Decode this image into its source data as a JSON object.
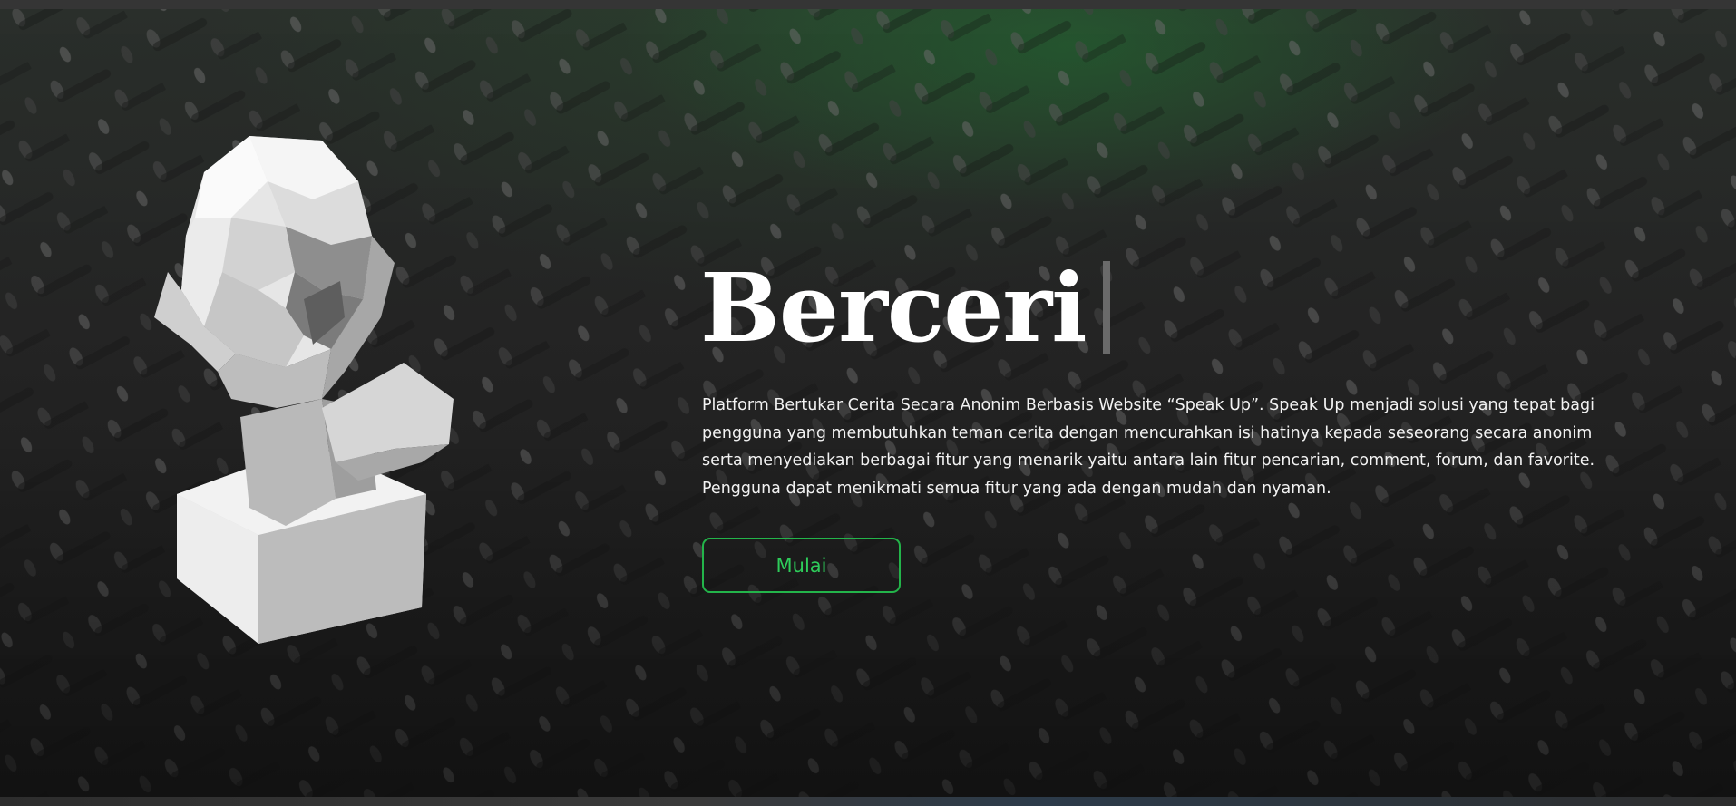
{
  "hero": {
    "headline": "Berceri",
    "description": "Platform Bertukar Cerita Secara Anonim Berbasis Website “Speak Up”. Speak Up menjadi solusi yang tepat bagi pengguna yang membutuhkan teman cerita dengan mencurahkan isi hatinya kepada seseorang secara anonim serta menyediakan berbagai fitur yang menarik yaitu antara lain fitur pencarian, comment, forum, dan favorite. Pengguna dapat menikmati semua fitur yang ada dengan mudah dan nyaman.",
    "cta_label": "Mulai",
    "illustration_icon": "low-poly-bust"
  },
  "colors": {
    "accent": "#2ecc5a",
    "button_border": "#23b44a",
    "background": "#1f1f1f",
    "text": "#ffffff"
  }
}
